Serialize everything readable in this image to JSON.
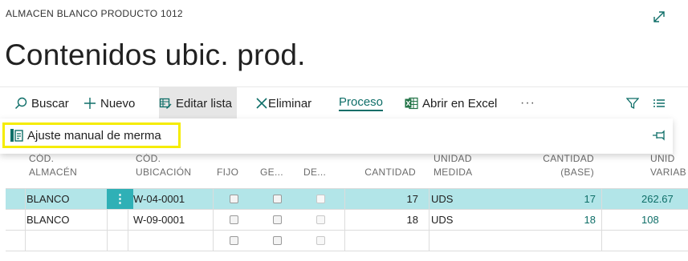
{
  "breadcrumb": "ALMACEN BLANCO PRODUCTO 1012",
  "page_title": "Contenidos ubic. prod.",
  "toolbar": {
    "search": "Buscar",
    "new": "Nuevo",
    "edit_list": "Editar lista",
    "delete": "Eliminar",
    "process": "Proceso",
    "open_excel": "Abrir en Excel",
    "more": "···"
  },
  "dropdown": {
    "item": "Ajuste manual de merma"
  },
  "columns": {
    "warehouse_1": "CÓD.",
    "warehouse_2": "ALMACÉN",
    "bin_1": "CÓD.",
    "bin_2": "UBICACIÓN",
    "fixed": "FIJO",
    "ge": "GE...",
    "de": "DE...",
    "quantity": "CANTIDAD",
    "uom_1": "UNIDAD",
    "uom_2": "MEDIDA",
    "qty_base_1": "CANTIDAD",
    "qty_base_2": "(BASE)",
    "unit_1": "UNID",
    "unit_2": "VARIAB"
  },
  "rows": [
    {
      "warehouse": "BLANCO",
      "bin": "W-04-0001",
      "quantity": "17",
      "uom": "UDS",
      "qty_base": "17",
      "variant": "262.67",
      "selected": true
    },
    {
      "warehouse": "BLANCO",
      "bin": "W-09-0001",
      "quantity": "18",
      "uom": "UDS",
      "qty_base": "18",
      "variant": "108",
      "selected": false
    }
  ],
  "colors": {
    "accent": "#0e6e68",
    "selected_row": "#b2e5e8",
    "highlight": "#f5ec00"
  }
}
